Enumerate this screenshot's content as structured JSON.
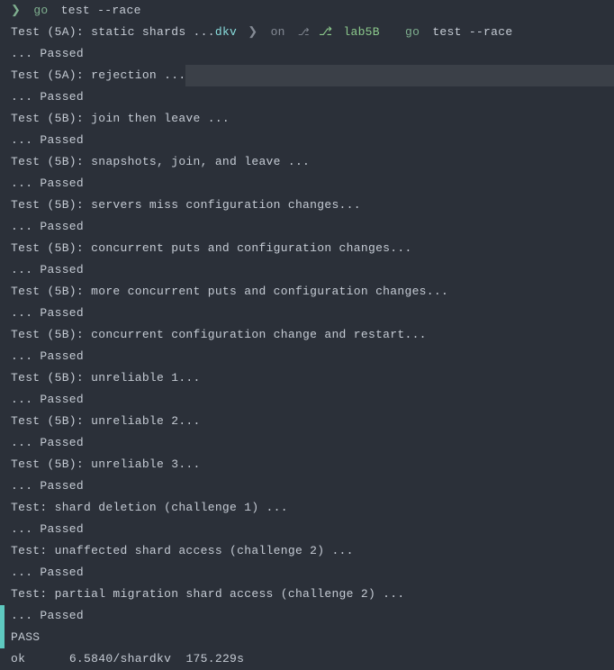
{
  "prompt1": {
    "symbol": "❯",
    "go": "go",
    "args": "test --race"
  },
  "line_5a_static": "Test (5A): static shards ...",
  "prompt2": {
    "dkv": "dkv",
    "on": "on",
    "branch": "lab5B",
    "go": "go",
    "args": "test --race"
  },
  "passed": "  ... Passed",
  "line_5a_rejection": "Test (5A): rejection ...",
  "line_5b_join": "Test (5B): join then leave ...",
  "line_5b_snapshots": "Test (5B): snapshots, join, and leave ...",
  "line_5b_servers": "Test (5B): servers miss configuration changes...",
  "line_5b_concurrent_puts": "Test (5B): concurrent puts and configuration changes...",
  "line_5b_more_concurrent": "Test (5B): more concurrent puts and configuration changes...",
  "line_5b_concurrent_config": "Test (5B): concurrent configuration change and restart...",
  "line_5b_unreliable1": "Test (5B): unreliable 1...",
  "line_5b_unreliable2": "Test (5B): unreliable 2...",
  "line_5b_unreliable3": "Test (5B): unreliable 3...",
  "line_shard_deletion": "Test: shard deletion (challenge 1) ...",
  "line_unaffected": "Test: unaffected shard access (challenge 2) ...",
  "line_partial": "Test: partial migration shard access (challenge 2) ...",
  "pass": "PASS",
  "ok_line": "ok  \t6.5840/shardkv\t175.229s"
}
